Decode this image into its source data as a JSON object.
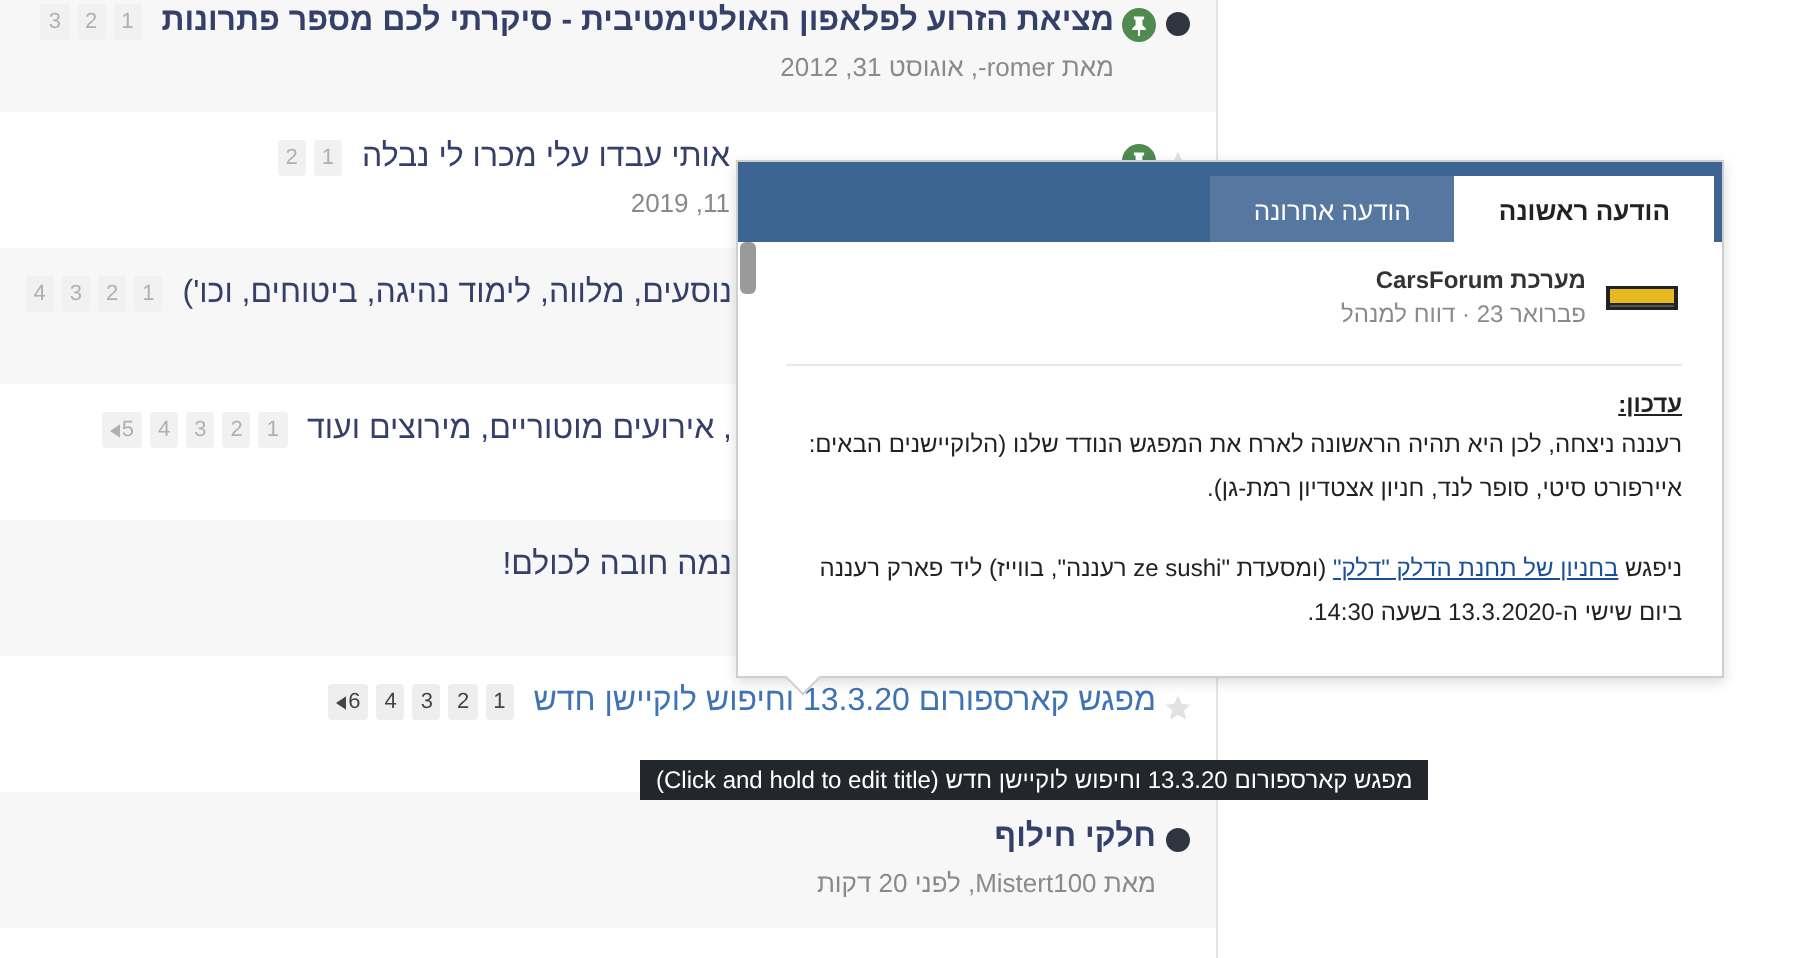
{
  "topics": [
    {
      "obscured": false,
      "unread": true,
      "pinned": true,
      "title": "מציאת הזרוע לפלאפון האולטימטיבית - סיקרתי לכם מספר פתרונות",
      "pages": [
        {
          "label": "1"
        },
        {
          "label": "2"
        },
        {
          "label": "3"
        }
      ],
      "meta": "מאת romer-, אוגוסט 31, 2012"
    },
    {
      "obscured": true,
      "unread": false,
      "pinned": true,
      "title": "אותי עבדו עלי מכרו לי נבלה",
      "pages": [
        {
          "label": "1"
        },
        {
          "label": "2"
        }
      ],
      "meta": "11, 2019"
    },
    {
      "obscured": true,
      "unread": false,
      "title": "נוסעים, מלווה, לימוד נהיגה, ביטוחים, וכו')",
      "pages": [
        {
          "label": "1"
        },
        {
          "label": "2"
        },
        {
          "label": "3"
        },
        {
          "label": "4"
        }
      ]
    },
    {
      "obscured": true,
      "unread": false,
      "title": ", אירועים מוטוריים, מירוצים ועוד",
      "pages": [
        {
          "label": "1"
        },
        {
          "label": "2"
        },
        {
          "label": "3"
        },
        {
          "label": "4"
        },
        {
          "label": "5",
          "last": true
        }
      ]
    },
    {
      "obscured": true,
      "unread": false,
      "title": "נמה חובה לכולם!"
    },
    {
      "obscured": false,
      "unread": false,
      "hovered": true,
      "title": "מפגש קארספורום 13.3.20 וחיפוש לוקיישן חדש",
      "pages": [
        {
          "label": "1"
        },
        {
          "label": "2"
        },
        {
          "label": "3"
        },
        {
          "label": "4"
        },
        {
          "label": "6",
          "last": true
        }
      ]
    },
    {
      "obscured": false,
      "unread": true,
      "title": "חלקי חילוף",
      "meta": "מאת Mistert100, לפני 20 דקות"
    }
  ],
  "preview": {
    "tabs": [
      {
        "label": "הודעה ראשונה",
        "selected": true
      },
      {
        "label": "הודעה אחרונה",
        "selected": false
      }
    ],
    "author": "מערכת CarsForum",
    "post_meta": "פברואר 23 · דווח למנהל",
    "heading": "עדכון:",
    "paragraph_1": "רעננה ניצחה, לכן היא תהיה הראשונה לארח את המפגש הנודד שלנו (הלוקיישנים הבאים: איירפורט סיטי, סופר לנד, חניון אצטדיון רמת-גן).",
    "paragraph_2": {
      "before": "ניפגש ",
      "link": "בחניון של תחנת הדלק \"דלק\"",
      "after": " (ומסעדת \"ze sushi רעננה\", בווייז) ליד פארק רעננה ביום שישי ה-13.3.2020 בשעה 14:30."
    }
  },
  "tooltip": "מפגש קארספורום 13.3.20 וחיפוש לוקיישן חדש (Click and hold to edit title)"
}
